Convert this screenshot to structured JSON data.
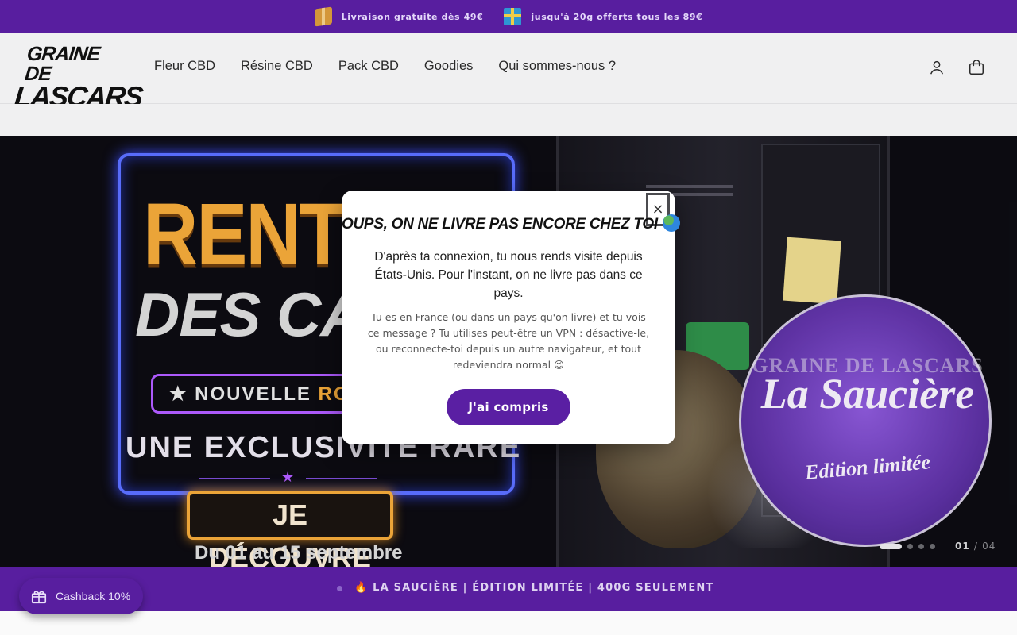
{
  "announcement": {
    "free_shipping": "Livraison gratuite dès 49€",
    "gift_offer": "jusqu'à 20g offerts tous les 89€",
    "icons": [
      "package-icon",
      "gift-icon"
    ]
  },
  "header": {
    "logo_line1": "GRAINE DE",
    "logo_line2": "LASCARS",
    "nav": [
      "Fleur CBD",
      "Résine CBD",
      "Pack CBD",
      "Goodies",
      "Qui sommes-nous ?"
    ],
    "icons": [
      "account-icon",
      "cart-icon"
    ]
  },
  "hero": {
    "headline": "RENT",
    "subheadline": "DES CAD",
    "rotation_prefix": "★ NOUVELLE ",
    "rotation_accent": "ROTA",
    "exclusive": "UNE EXCLUSIVITÉ RARE",
    "cta": "JE DÉCOUVRE",
    "dates": "Du 01 au 15 septembre",
    "product_brand": "GRAINE DE LASCARS",
    "product_name": "La Saucière",
    "product_edition": "Edition limitée",
    "slide_current": "01",
    "slide_separator": "/",
    "slide_total": "04",
    "slide_count": 4,
    "active_slide_index": 0
  },
  "ticker": {
    "text": "🔥 LA SAUCIÈRE | ÉDITION LIMITÉE | 400G SEULEMENT"
  },
  "cashback": {
    "label": "Cashback 10%"
  },
  "modal": {
    "close_label": "×",
    "title": "OUPS, ON NE LIVRE PAS ENCORE CHEZ TOI",
    "lead": "D'après ta connexion, tu nous rends visite depuis États-Unis. Pour l'instant, on ne livre pas dans ce pays.",
    "body": "Tu es en France (ou dans un pays qu'on livre) et tu vois ce message ? Tu utilises peut-être un VPN : désactive-le, ou reconnecte-toi depuis un autre navigateur, et tout redeviendra normal 😉",
    "button": "J'ai compris"
  },
  "colors": {
    "brand_purple": "#5a1fa3",
    "accent_orange": "#f0a83a",
    "header_bg": "#f5f5f6"
  }
}
